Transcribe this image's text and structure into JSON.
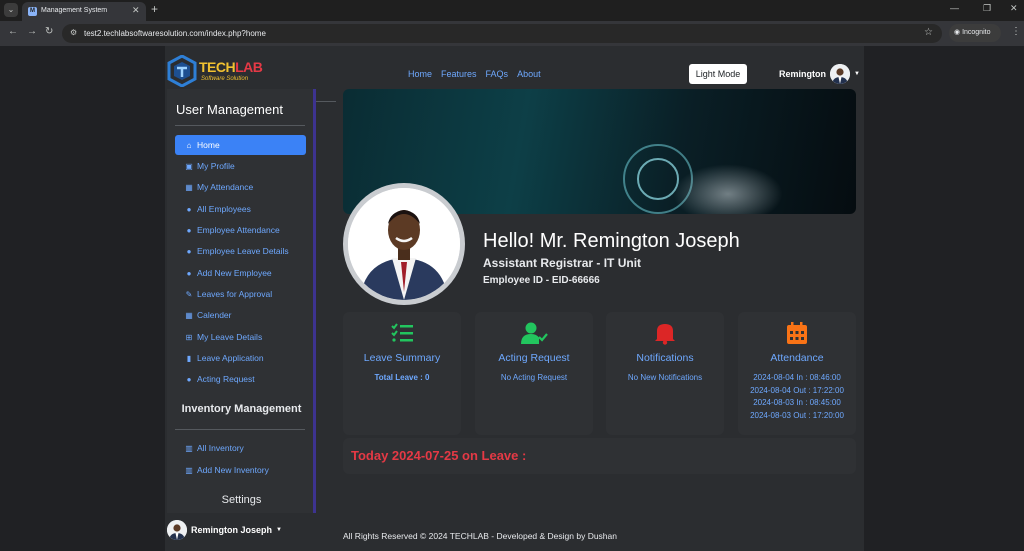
{
  "browser": {
    "tab_title": "Management System",
    "url": "test2.techlabsoftwaresolution.com/index.php?home",
    "profile_label": "Incognito"
  },
  "navbar": {
    "logo_primary": "TECH",
    "logo_accent": "LAB",
    "logo_tagline": "Software Solution",
    "links": [
      "Home",
      "Features",
      "FAQs",
      "About"
    ],
    "theme_button": "Light Mode",
    "user_name": "Remington"
  },
  "sidebar": {
    "title": "User Management",
    "items": [
      {
        "label": "Home",
        "icon": "home-icon"
      },
      {
        "label": "My Profile",
        "icon": "id-card-icon"
      },
      {
        "label": "My Attendance",
        "icon": "calendar-icon"
      },
      {
        "label": "All Employees",
        "icon": "user-icon"
      },
      {
        "label": "Employee Attendance",
        "icon": "user-icon"
      },
      {
        "label": "Employee Leave Details",
        "icon": "user-icon"
      },
      {
        "label": "Add New Employee",
        "icon": "user-plus-icon"
      },
      {
        "label": "Leaves for Approval",
        "icon": "file-edit-icon"
      },
      {
        "label": "Calender",
        "icon": "calendar-icon"
      },
      {
        "label": "My Leave Details",
        "icon": "table-icon"
      },
      {
        "label": "Leave Application",
        "icon": "file-icon"
      },
      {
        "label": "Acting Request",
        "icon": "user-gear-icon"
      }
    ],
    "inventory_title": "Inventory Management",
    "inventory_items": [
      {
        "label": "All Inventory",
        "icon": "building-icon"
      },
      {
        "label": "Add New Inventory",
        "icon": "building-plus-icon"
      }
    ],
    "settings_title": "Settings",
    "footer_user": "Remington Joseph"
  },
  "profile": {
    "greeting": "Hello! Mr. Remington Joseph",
    "position": "Assistant Registrar - IT Unit",
    "employee_id": "Employee ID - EID-66666"
  },
  "cards": [
    {
      "title": "Leave Summary",
      "icon": "checklist-icon",
      "color": "#22c55e",
      "lines": [
        "Total Leave : 0"
      ]
    },
    {
      "title": "Acting Request",
      "icon": "user-check-icon",
      "color": "#22c55e",
      "lines": [
        "No Acting Request"
      ]
    },
    {
      "title": "Notifications",
      "icon": "bell-icon",
      "color": "#dc2626",
      "lines": [
        "No New Notifications"
      ]
    },
    {
      "title": "Attendance",
      "icon": "calendar-icon",
      "color": "#f97316",
      "lines": [
        "2024-08-04 In : 08:46:00",
        "2024-08-04 Out : 17:22:00",
        "2024-08-03 In : 08:45:00",
        "2024-08-03 Out : 17:20:00"
      ]
    }
  ],
  "leave_today": "Today 2024-07-25 on Leave :",
  "footer": "All Rights Reserved © 2024 TECHLAB - Developed & Design by Dushan",
  "colors": {
    "accent": "#3b82f6",
    "link": "#6ea8fe",
    "alert": "#e53945"
  }
}
